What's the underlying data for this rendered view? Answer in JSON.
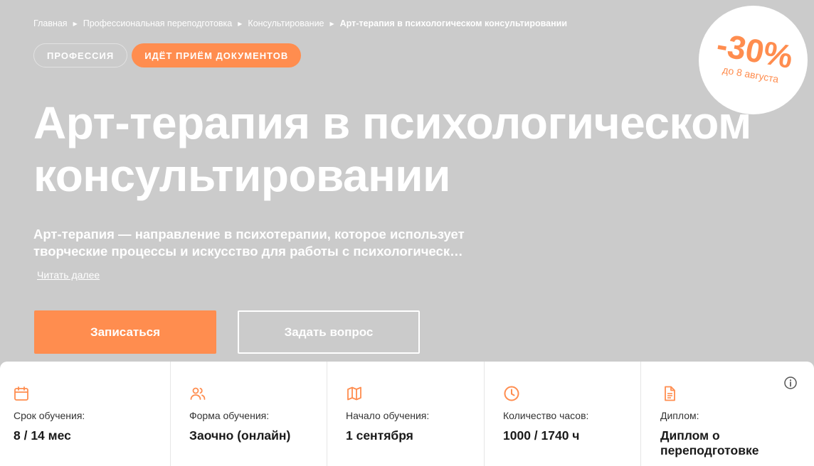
{
  "breadcrumb": {
    "items": [
      "Главная",
      "Профессиональная переподготовка",
      "Консультирование"
    ],
    "current": "Арт-терапия в психологическом консультировании",
    "separator": "▶"
  },
  "tags": {
    "profession": "ПРОФЕССИЯ",
    "status": "ИДЁТ ПРИЁМ ДОКУМЕНТОВ"
  },
  "discount": {
    "value": "-30%",
    "until": "до 8 августа"
  },
  "title": {
    "line1": "Арт-терапия в психологическом",
    "line2": "консультировании"
  },
  "description": {
    "line1": "Арт-терапия — направление в психотерапии, которое использует",
    "line2": "творческие процессы и искусство для работы с психологическ…"
  },
  "read_more": "Читать далее",
  "buttons": {
    "enroll": "Записаться",
    "ask": "Задать вопрос"
  },
  "facts": [
    {
      "icon": "calendar-icon",
      "label": "Срок обучения:",
      "value": "8 / 14 мес"
    },
    {
      "icon": "users-icon",
      "label": "Форма обучения:",
      "value": "Заочно (онлайн)"
    },
    {
      "icon": "map-icon",
      "label": "Начало обучения:",
      "value": "1 сентября"
    },
    {
      "icon": "clock-icon",
      "label": "Количество часов:",
      "value": "1000 / 1740 ч"
    },
    {
      "icon": "document-icon",
      "label": "Диплом:",
      "value_line1": "Диплом о",
      "value_line2": "переподготовке"
    }
  ],
  "colors": {
    "accent": "#ff8d4f",
    "hero_background": "#cbcbcb"
  }
}
